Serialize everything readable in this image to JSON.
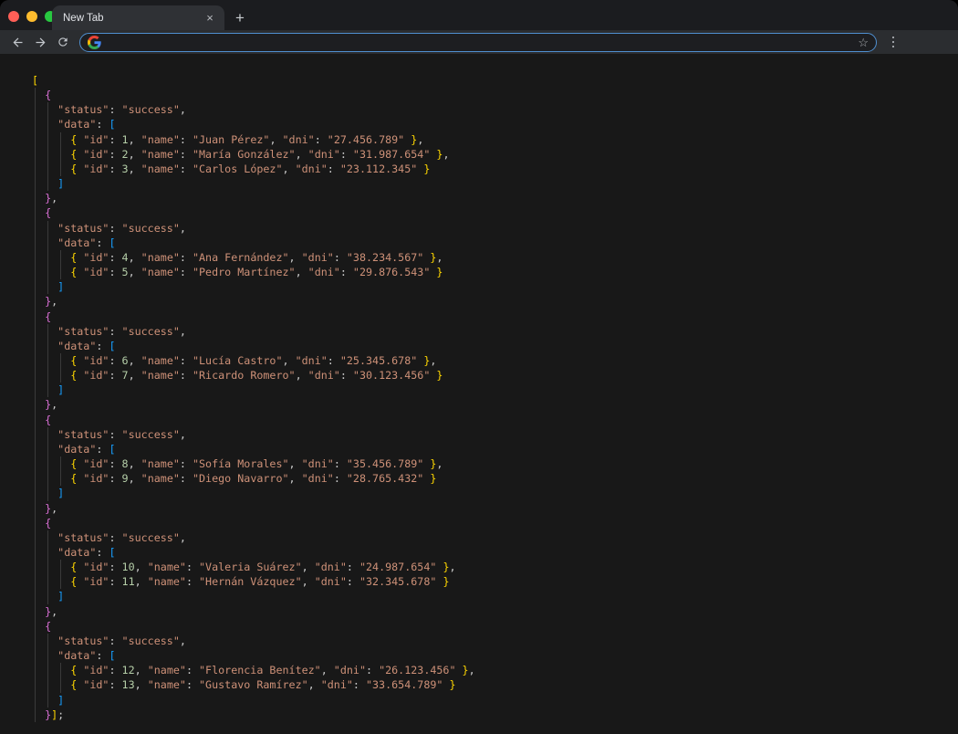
{
  "window": {
    "traffic_lights": {
      "close": "#ff5f57",
      "minimize": "#febc2e",
      "zoom": "#28c840"
    }
  },
  "browser": {
    "tab_title": "New Tab",
    "address_value": "",
    "icons": {
      "close_tab": "×",
      "new_tab": "+",
      "back": "arrow-left",
      "forward": "arrow-right",
      "reload": "circular-arrow",
      "search_engine": "google-g",
      "bookmark_star": "☆",
      "menu": "kebab-dots"
    }
  },
  "json_view": {
    "keys": {
      "status": "status",
      "data": "data",
      "id": "id",
      "name": "name",
      "dni": "dni"
    },
    "statement_terminator": ";",
    "blocks": [
      {
        "status": "success",
        "data": [
          {
            "id": 1,
            "name": "Juan Pérez",
            "dni": "27.456.789"
          },
          {
            "id": 2,
            "name": "María González",
            "dni": "31.987.654"
          },
          {
            "id": 3,
            "name": "Carlos López",
            "dni": "23.112.345"
          }
        ]
      },
      {
        "status": "success",
        "data": [
          {
            "id": 4,
            "name": "Ana Fernández",
            "dni": "38.234.567"
          },
          {
            "id": 5,
            "name": "Pedro Martínez",
            "dni": "29.876.543"
          }
        ]
      },
      {
        "status": "success",
        "data": [
          {
            "id": 6,
            "name": "Lucía Castro",
            "dni": "25.345.678"
          },
          {
            "id": 7,
            "name": "Ricardo Romero",
            "dni": "30.123.456"
          }
        ]
      },
      {
        "status": "success",
        "data": [
          {
            "id": 8,
            "name": "Sofía Morales",
            "dni": "35.456.789"
          },
          {
            "id": 9,
            "name": "Diego Navarro",
            "dni": "28.765.432"
          }
        ]
      },
      {
        "status": "success",
        "data": [
          {
            "id": 10,
            "name": "Valeria Suárez",
            "dni": "24.987.654"
          },
          {
            "id": 11,
            "name": "Hernán Vázquez",
            "dni": "32.345.678"
          }
        ]
      },
      {
        "status": "success",
        "data": [
          {
            "id": 12,
            "name": "Florencia Benítez",
            "dni": "26.123.456"
          },
          {
            "id": 13,
            "name": "Gustavo Ramírez",
            "dni": "33.654.789"
          }
        ]
      }
    ],
    "syntax_colors": {
      "background": "#181818",
      "string": "#ce9178",
      "number": "#b5cea8",
      "punctuation": "#cccccc",
      "bracket_level1": "#ffd700",
      "bracket_level2": "#da70d6",
      "bracket_level3": "#179fff",
      "indent_guide": "#3a3a3a"
    }
  }
}
